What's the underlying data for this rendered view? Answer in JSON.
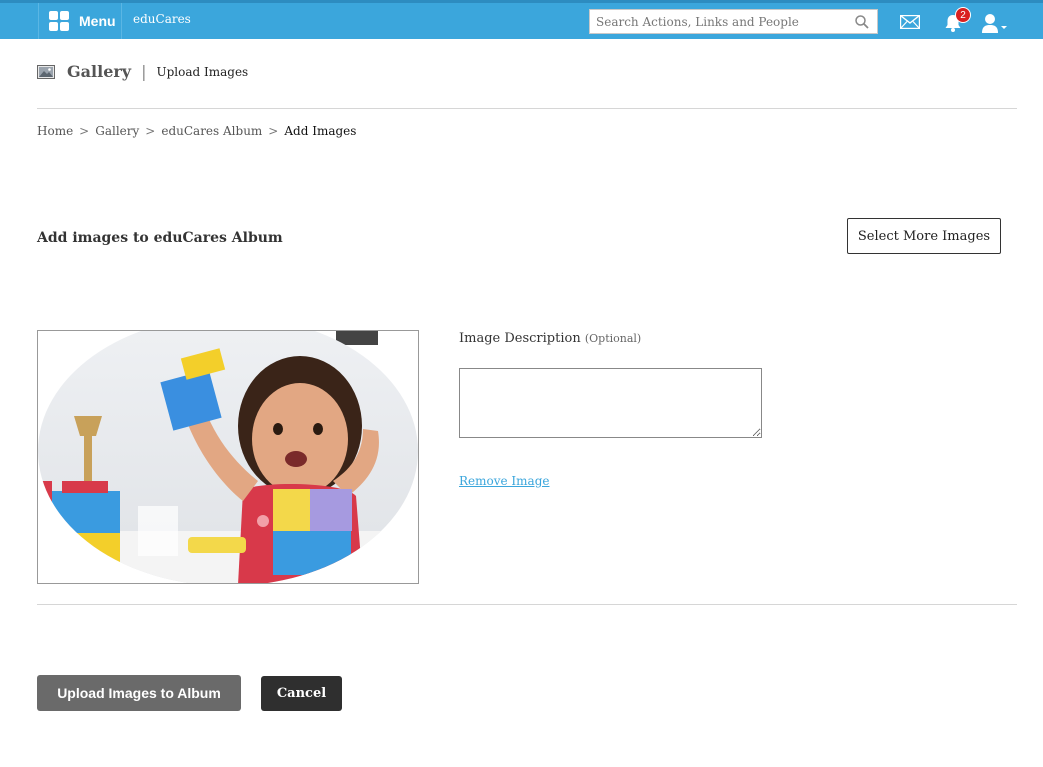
{
  "topbar": {
    "menu_label": "Menu",
    "brand": "eduCares",
    "search_placeholder": "Search Actions, Links and People",
    "notification_count": "2",
    "bar_color": "#3ba6dc"
  },
  "header": {
    "title": "Gallery",
    "separator": "|",
    "subtitle": "Upload Images"
  },
  "breadcrumb": {
    "items": [
      "Home",
      "Gallery",
      "eduCares Album",
      "Add Images"
    ],
    "separator": ">"
  },
  "section": {
    "title": "Add images to eduCares Album",
    "select_more_label": "Select More Images"
  },
  "image_item": {
    "description_label": "Image Description",
    "optional_label": "(Optional)",
    "description_value": "",
    "remove_label": "Remove Image"
  },
  "actions": {
    "upload_label": "Upload Images to Album",
    "cancel_label": "Cancel"
  }
}
